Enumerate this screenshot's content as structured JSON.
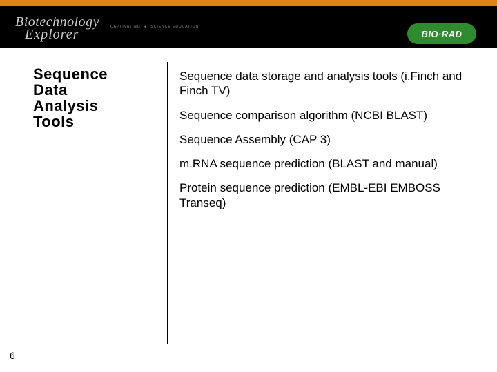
{
  "header": {
    "logo_line1": "Biotechnology",
    "logo_line2": "Explorer",
    "logo_tag_left": "CAPTIVATING",
    "logo_tag_right": "SCIENCE EDUCATION",
    "biorad_label": "BIO·RAD"
  },
  "title": {
    "l1": "Sequence",
    "l2": "Data",
    "l3": "Analysis",
    "l4": "Tools"
  },
  "bullets": [
    "Sequence data storage and analysis tools (i.Finch and Finch TV)",
    "Sequence comparison algorithm (NCBI BLAST)",
    "Sequence Assembly (CAP 3)",
    "m.RNA sequence prediction (BLAST and manual)",
    "Protein sequence prediction (EMBL-EBI EMBOSS Transeq)"
  ],
  "page_number": "6"
}
